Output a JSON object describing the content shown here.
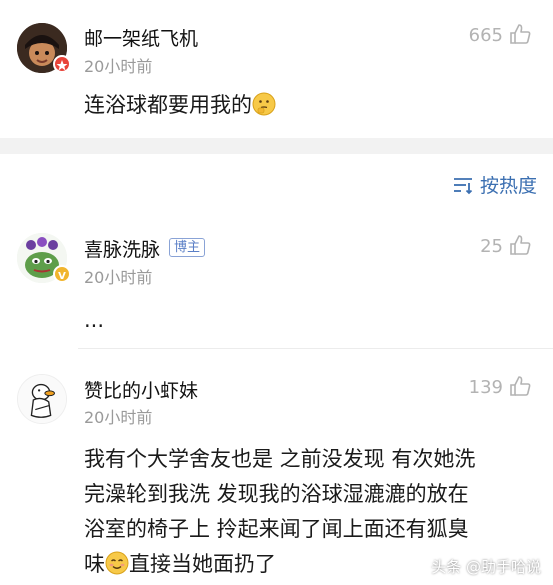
{
  "comments": [
    {
      "name": "邮一架纸飞机",
      "time": "20小时前",
      "likes": "665",
      "content": "连浴球都要用我的",
      "content_emoji": "thinking-face-emoji"
    },
    {
      "name": "喜脉洗脉",
      "tag": "博主",
      "time": "20小时前",
      "likes": "25",
      "content": "..."
    },
    {
      "name": "赞比的小虾妹",
      "time": "20小时前",
      "likes": "139",
      "content_lines": [
        "我有个大学舍友也是 之前没发现 有次她洗",
        "完澡轮到我洗 发现我的浴球湿漉漉的放在",
        "浴室的椅子上 拎起来闻了闻上面还有狐臭",
        "直接当她面扔了"
      ],
      "content_line4_prefix": "味",
      "content_emoji": "smiling-face-emoji"
    }
  ],
  "sort": {
    "label": "按热度",
    "icon": "sort-icon"
  },
  "watermark": "头条 @助手哈说",
  "colors": {
    "link": "#3b6fb1",
    "muted": "#9a9a9a",
    "band": "#f2f2f2"
  }
}
